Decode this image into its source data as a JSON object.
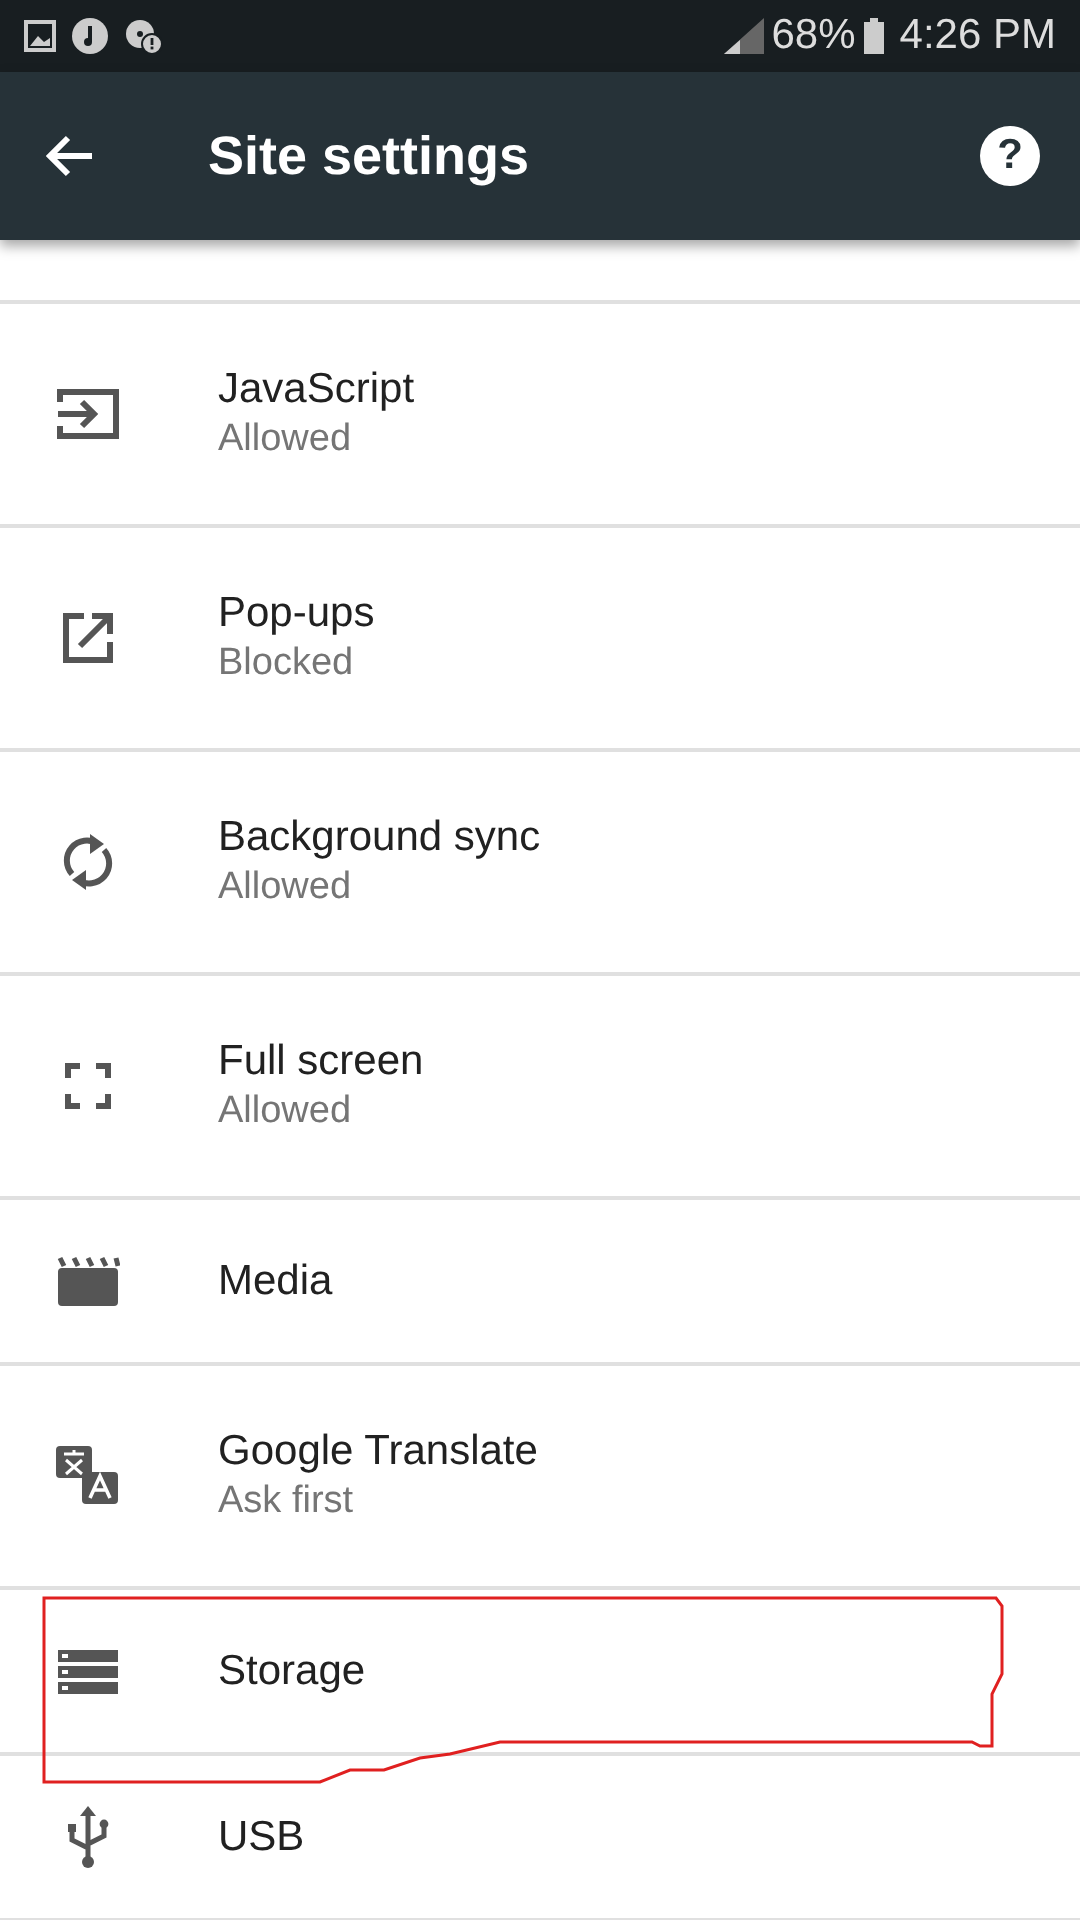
{
  "status_bar": {
    "battery": "68%",
    "time": "4:26 PM"
  },
  "toolbar": {
    "title": "Site settings",
    "help": "?"
  },
  "settings": [
    {
      "title": "JavaScript",
      "subtitle": "Allowed",
      "highlighted": false
    },
    {
      "title": "Pop-ups",
      "subtitle": "Blocked",
      "highlighted": false
    },
    {
      "title": "Background sync",
      "subtitle": "Allowed",
      "highlighted": false
    },
    {
      "title": "Full screen",
      "subtitle": "Allowed",
      "highlighted": false
    },
    {
      "title": "Media",
      "highlighted": false
    },
    {
      "title": "Google Translate",
      "subtitle": "Ask first",
      "highlighted": false
    },
    {
      "title": "Storage",
      "highlighted": true
    },
    {
      "title": "USB",
      "highlighted": false
    }
  ]
}
